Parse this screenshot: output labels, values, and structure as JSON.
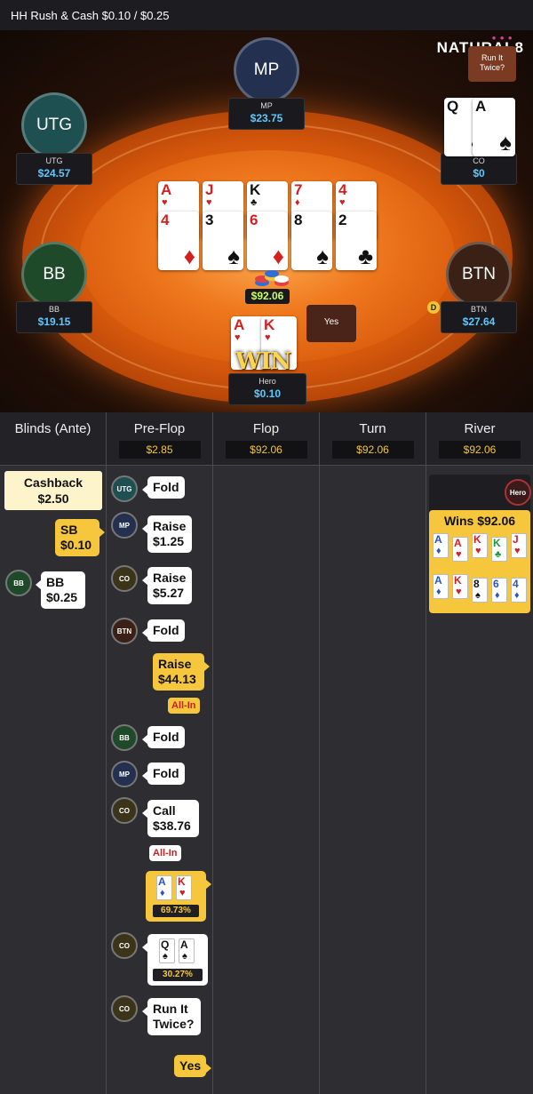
{
  "title": "HH  Rush & Cash $0.10 / $0.25",
  "logo": "NATURAL8",
  "table": {
    "seats": [
      {
        "pos": "MP",
        "label": "MP",
        "stack": "$23.75",
        "color": "#23304f"
      },
      {
        "pos": "UTG",
        "label": "UTG",
        "stack": "$24.57",
        "color": "#1e5052"
      },
      {
        "pos": "CO",
        "label": "CO",
        "stack": "$0",
        "color": "#3b3418"
      },
      {
        "pos": "BB",
        "label": "BB",
        "stack": "$19.15",
        "color": "#1f4a2a"
      },
      {
        "pos": "BTN",
        "label": "BTN",
        "stack": "$27.64",
        "color": "#3b2015"
      },
      {
        "pos": "Hero",
        "label": "Hero",
        "stack": "$0.10",
        "color": "#4a1d1d"
      }
    ],
    "run_it_twice_bubble": "Run It Twice?",
    "yes_bubble": "Yes",
    "dealer": "D",
    "pot": "$92.06",
    "board_row1": [
      {
        "rank": "A",
        "suit": "♥",
        "color": "red"
      },
      {
        "rank": "J",
        "suit": "♥",
        "color": "red"
      },
      {
        "rank": "K",
        "suit": "♣",
        "color": "black"
      },
      {
        "rank": "7",
        "suit": "♦",
        "color": "red"
      },
      {
        "rank": "4",
        "suit": "♥",
        "color": "red"
      }
    ],
    "board_row2": [
      {
        "rank": "4",
        "suit": "♦",
        "color": "red"
      },
      {
        "rank": "3",
        "suit": "♠",
        "color": "black"
      },
      {
        "rank": "6",
        "suit": "♦",
        "color": "red"
      },
      {
        "rank": "8",
        "suit": "♠",
        "color": "black"
      },
      {
        "rank": "2",
        "suit": "♣",
        "color": "black"
      }
    ],
    "co_cards": [
      {
        "rank": "Q",
        "suit": "♠",
        "color": "black"
      },
      {
        "rank": "A",
        "suit": "♠",
        "color": "black"
      }
    ],
    "hero_cards": [
      {
        "rank": "A",
        "suit": "♥",
        "color": "red"
      },
      {
        "rank": "K",
        "suit": "♥",
        "color": "red"
      }
    ],
    "win_text": "WIN"
  },
  "history": {
    "columns": [
      {
        "title": "Blinds (Ante)",
        "pot": ""
      },
      {
        "title": "Pre-Flop",
        "pot": "$2.85"
      },
      {
        "title": "Flop",
        "pot": "$92.06"
      },
      {
        "title": "Turn",
        "pot": "$92.06"
      },
      {
        "title": "River",
        "pot": "$92.06"
      }
    ],
    "blinds": {
      "cashback_label": "Cashback",
      "cashback_amount": "$2.50",
      "sb_label": "SB",
      "sb_amount": "$0.10",
      "bb_chip": "BB",
      "bb_label": "BB",
      "bb_amount": "$0.25"
    },
    "preflop": [
      {
        "chip": "UTG",
        "line1": "Fold",
        "line2": ""
      },
      {
        "chip": "MP",
        "line1": "Raise",
        "line2": "$1.25"
      },
      {
        "chip": "CO",
        "line1": "Raise",
        "line2": "$5.27"
      },
      {
        "chip": "BTN",
        "line1": "Fold",
        "line2": ""
      },
      {
        "chip": "",
        "line1": "Raise",
        "line2": "$44.13"
      },
      {
        "chip": "BB",
        "line1": "Fold",
        "line2": ""
      },
      {
        "chip": "MP",
        "line1": "Fold",
        "line2": ""
      },
      {
        "chip": "CO",
        "line1": "Call",
        "line2": "$38.76"
      }
    ],
    "allin_label": "All-In",
    "hero_equity": {
      "cards": [
        {
          "rank": "A",
          "suit": "♦",
          "color": "blue"
        },
        {
          "rank": "K",
          "suit": "♥",
          "color": "red"
        }
      ],
      "pct": "69.73%"
    },
    "co_equity": {
      "chip": "CO",
      "cards": [
        {
          "rank": "Q",
          "suit": "♠",
          "color": "black"
        },
        {
          "rank": "A",
          "suit": "♠",
          "color": "black"
        }
      ],
      "pct": "30.27%"
    },
    "rit_question": {
      "chip": "CO",
      "line1": "Run It",
      "line2": "Twice?"
    },
    "rit_answer": "Yes",
    "river": {
      "hero_chip": "Hero",
      "wins": "Wins $92.06",
      "row1": [
        {
          "rank": "A",
          "suit": "♦",
          "color": "blue"
        },
        {
          "rank": "A",
          "suit": "♥",
          "color": "red"
        },
        {
          "rank": "K",
          "suit": "♥",
          "color": "red"
        },
        {
          "rank": "K",
          "suit": "♣",
          "color": "green"
        },
        {
          "rank": "J",
          "suit": "♥",
          "color": "red"
        }
      ],
      "row2": [
        {
          "rank": "A",
          "suit": "♦",
          "color": "blue"
        },
        {
          "rank": "K",
          "suit": "♥",
          "color": "red"
        },
        {
          "rank": "8",
          "suit": "♠",
          "color": "black"
        },
        {
          "rank": "6",
          "suit": "♦",
          "color": "blue"
        },
        {
          "rank": "4",
          "suit": "♦",
          "color": "blue"
        }
      ]
    }
  }
}
